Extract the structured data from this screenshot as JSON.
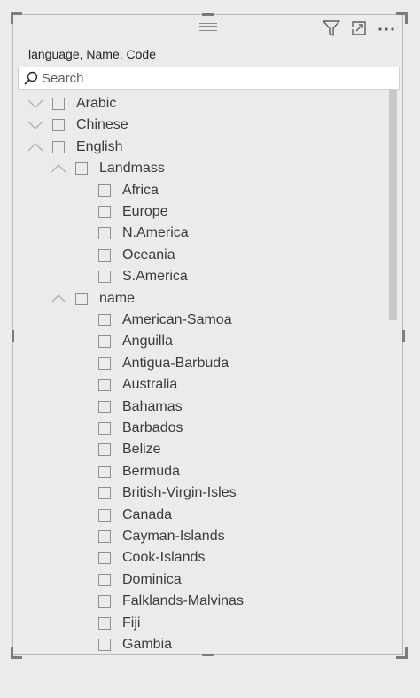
{
  "header": {
    "title": "language, Name, Code",
    "icons": [
      "filter-icon",
      "focus-mode-icon",
      "more-options-icon"
    ]
  },
  "search": {
    "placeholder": "Search",
    "value": ""
  },
  "tree": [
    {
      "label": "Arabic",
      "level": 0,
      "expanded": false
    },
    {
      "label": "Chinese",
      "level": 0,
      "expanded": false
    },
    {
      "label": "English",
      "level": 0,
      "expanded": true
    },
    {
      "label": "Landmass",
      "level": 1,
      "expanded": true
    },
    {
      "label": "Africa",
      "level": 2
    },
    {
      "label": "Europe",
      "level": 2
    },
    {
      "label": "N.America",
      "level": 2
    },
    {
      "label": "Oceania",
      "level": 2
    },
    {
      "label": "S.America",
      "level": 2
    },
    {
      "label": "name",
      "level": 1,
      "expanded": true
    },
    {
      "label": "American-Samoa",
      "level": 2
    },
    {
      "label": "Anguilla",
      "level": 2
    },
    {
      "label": "Antigua-Barbuda",
      "level": 2
    },
    {
      "label": "Australia",
      "level": 2
    },
    {
      "label": "Bahamas",
      "level": 2
    },
    {
      "label": "Barbados",
      "level": 2
    },
    {
      "label": "Belize",
      "level": 2
    },
    {
      "label": "Bermuda",
      "level": 2
    },
    {
      "label": "British-Virgin-Isles",
      "level": 2
    },
    {
      "label": "Canada",
      "level": 2
    },
    {
      "label": "Cayman-Islands",
      "level": 2
    },
    {
      "label": "Cook-Islands",
      "level": 2
    },
    {
      "label": "Dominica",
      "level": 2
    },
    {
      "label": "Falklands-Malvinas",
      "level": 2
    },
    {
      "label": "Fiji",
      "level": 2
    },
    {
      "label": "Gambia",
      "level": 2
    }
  ],
  "colors": {
    "background": "#ebebed",
    "text": "#3b3a39",
    "checkbox_border": "#8f8f8f",
    "scrollbar": "#c8c8c8"
  }
}
